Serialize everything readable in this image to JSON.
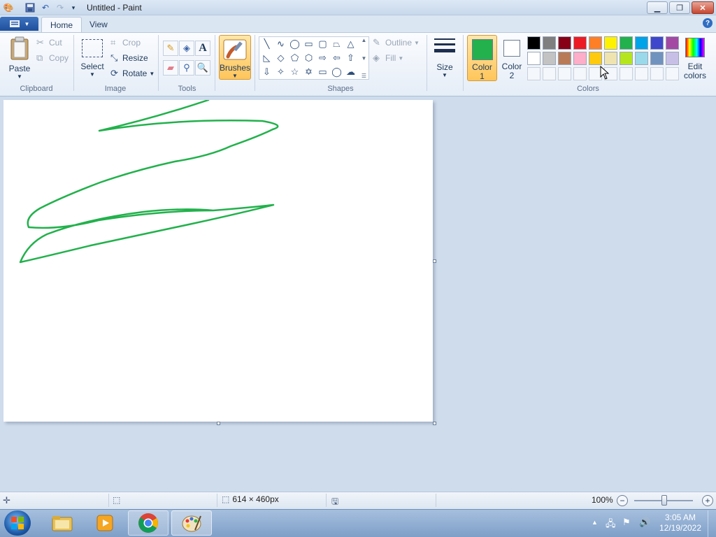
{
  "window": {
    "title": "Untitled - Paint"
  },
  "tabs": {
    "home": "Home",
    "view": "View"
  },
  "clipboard": {
    "paste": "Paste",
    "cut": "Cut",
    "copy": "Copy",
    "group": "Clipboard"
  },
  "image": {
    "select": "Select",
    "crop": "Crop",
    "resize": "Resize",
    "rotate": "Rotate",
    "group": "Image"
  },
  "tools": {
    "group": "Tools"
  },
  "brushes": {
    "label": "Brushes"
  },
  "shapes": {
    "outline": "Outline",
    "fill": "Fill",
    "group": "Shapes"
  },
  "size": {
    "label": "Size"
  },
  "colors": {
    "color1_line1": "Color",
    "color1_line2": "1",
    "color2_line1": "Color",
    "color2_line2": "2",
    "edit_line1": "Edit",
    "edit_line2": "colors",
    "group": "Colors",
    "color1_value": "#22b14c",
    "color2_value": "#ffffff",
    "palette_row1": [
      "#000000",
      "#7f7f7f",
      "#880015",
      "#ed1c24",
      "#ff7f27",
      "#fff200",
      "#22b14c",
      "#00a2e8",
      "#3f48cc",
      "#a349a4"
    ],
    "palette_row2": [
      "#ffffff",
      "#c3c3c3",
      "#b97a57",
      "#ffaec9",
      "#ffc90e",
      "#efe4b0",
      "#b5e61d",
      "#99d9ea",
      "#7092be",
      "#c8bfe7"
    ]
  },
  "status": {
    "canvas_size": "614 × 460px",
    "zoom": "100%"
  },
  "taskbar": {
    "time": "3:05 AM",
    "date": "12/19/2022"
  }
}
